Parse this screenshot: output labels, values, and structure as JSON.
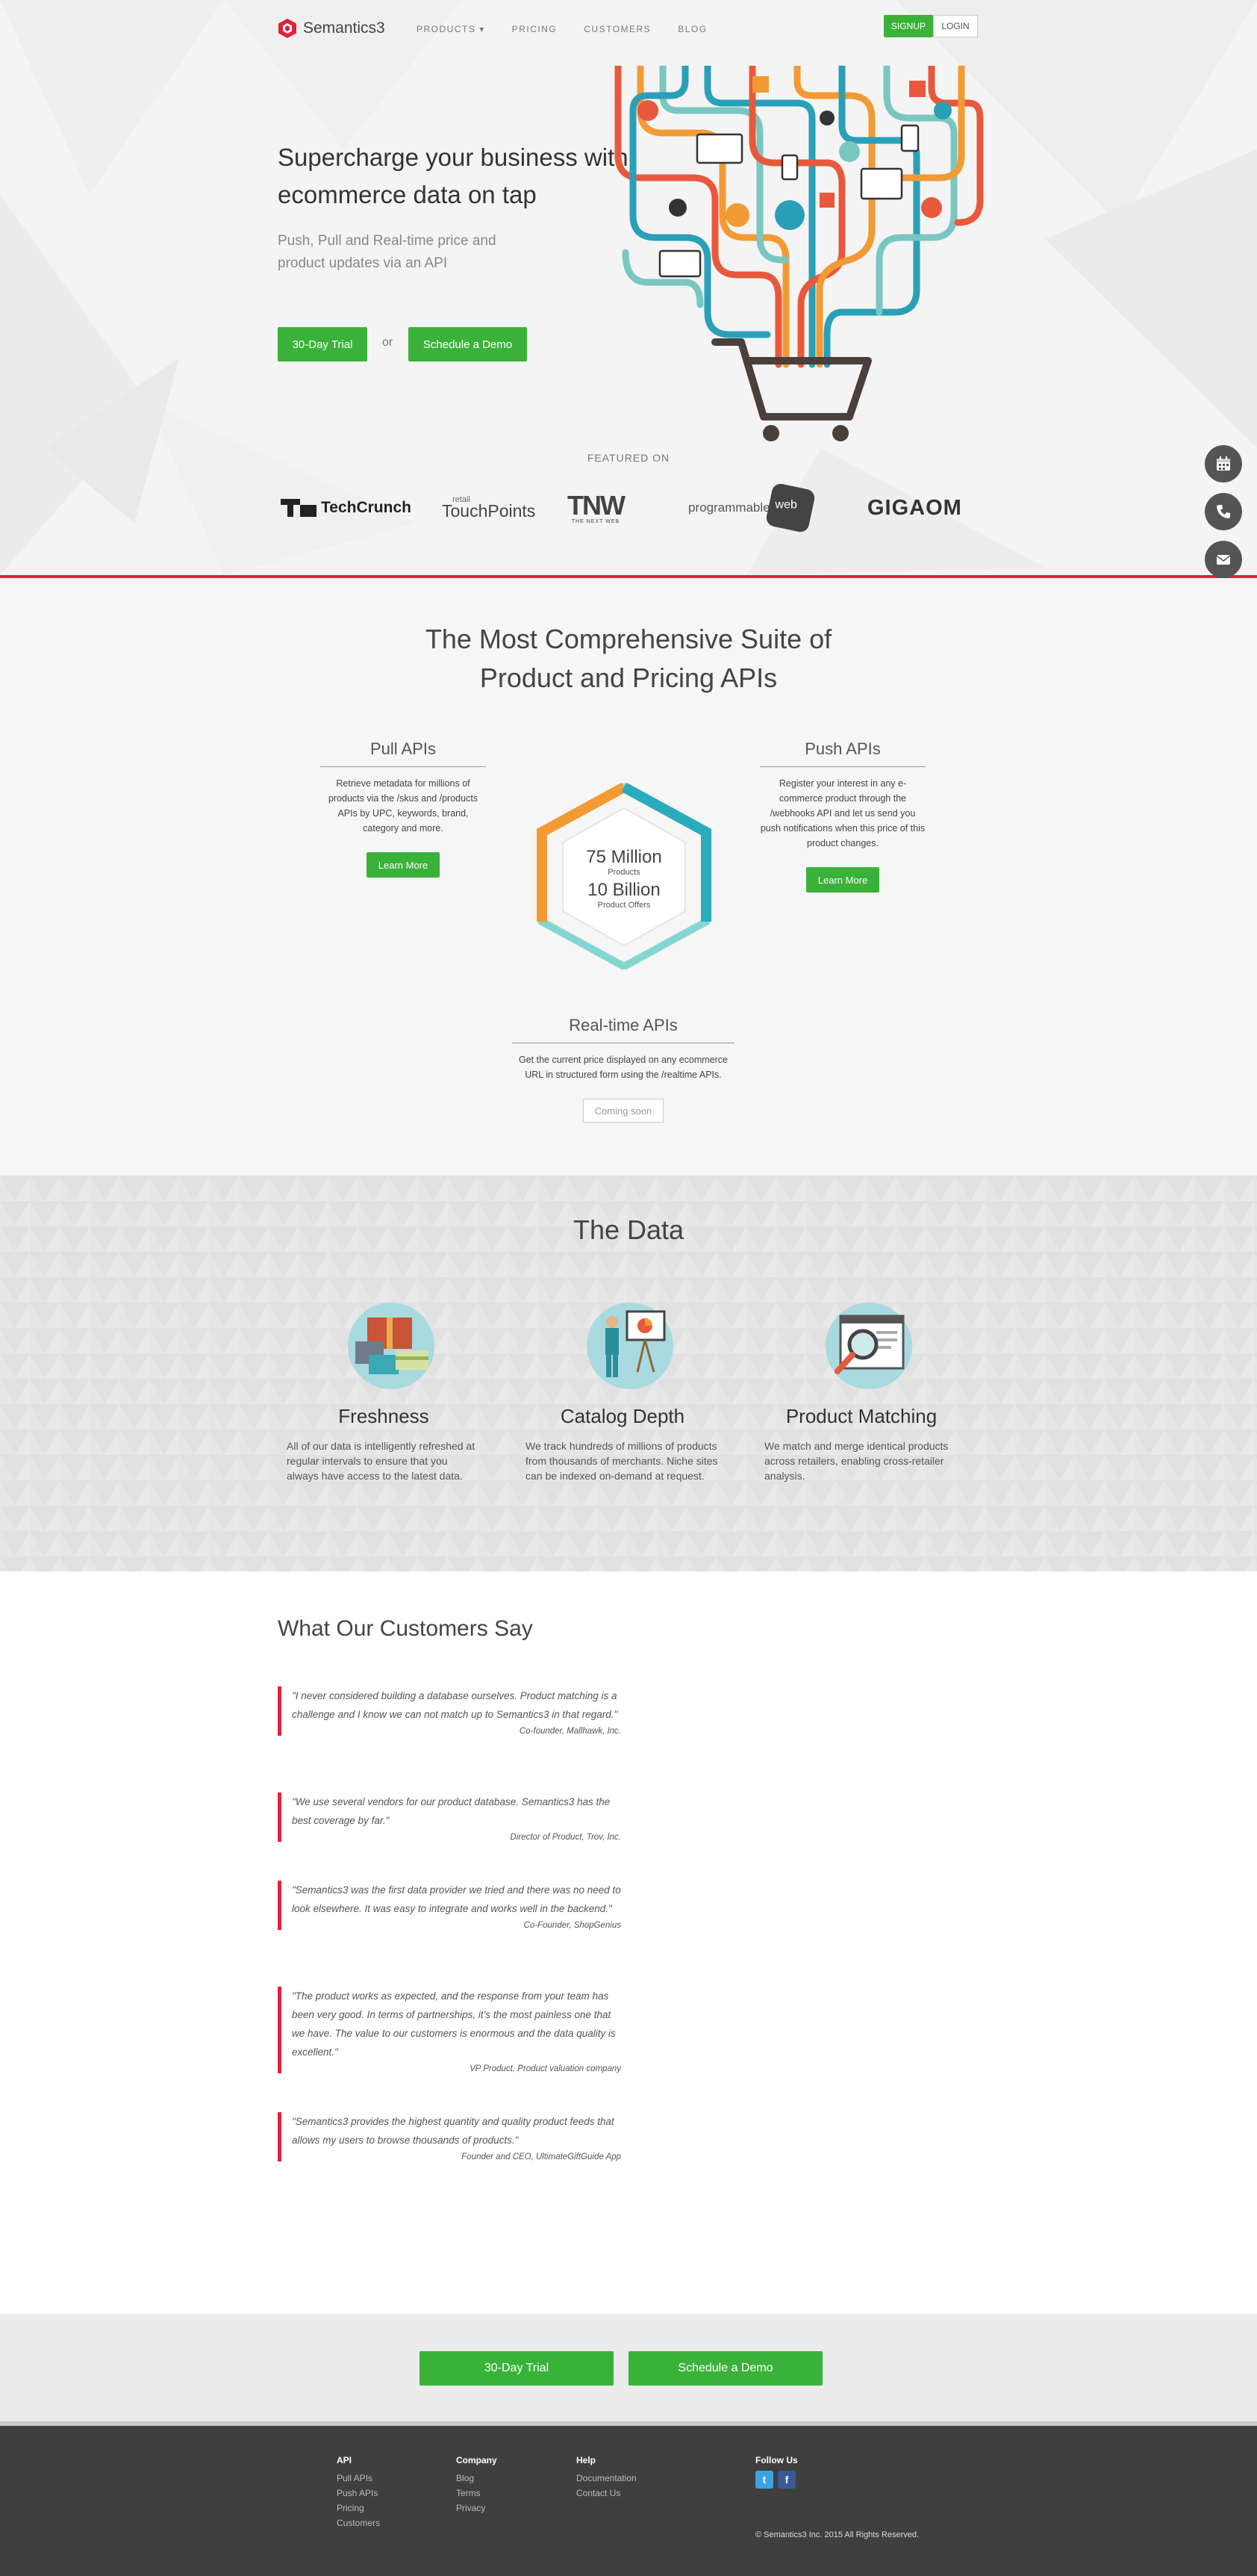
{
  "brand": {
    "name": "Semantics3",
    "accent": "#e4203e",
    "green": "#3ab23a"
  },
  "nav": {
    "links": [
      "PRODUCTS",
      "PRICING",
      "CUSTOMERS",
      "BLOG"
    ],
    "signup": "SIGNUP",
    "login": "LOGIN"
  },
  "hero": {
    "title": "Supercharge your business with ecommerce data on tap",
    "subtitle": "Push, Pull and Real-time price and product updates via an API",
    "trial": "30-Day Trial",
    "or": "or",
    "demo": "Schedule a Demo",
    "featured": "FEATURED ON",
    "press": {
      "techcrunch": "TechCrunch",
      "touchpoints_small": "retail",
      "touchpoints": "TouchPoints",
      "tnw": "TNW",
      "tnw_sub": "THE NEXT WEB",
      "programmable": "programmable",
      "programmable_web": "web",
      "gigaom": "GIGAOM"
    }
  },
  "suite": {
    "title_line1": "The Most Comprehensive Suite of",
    "title_line2": "Product and Pricing APIs",
    "pull": {
      "heading": "Pull APIs",
      "desc": "Retrieve metadata for millions of products via the /skus and /products APIs by UPC, keywords, brand, category and more.",
      "button": "Learn More"
    },
    "push": {
      "heading": "Push APIs",
      "desc": "Register your interest in any e-commerce product through the /webhooks API and let us send you push notifications when this price of this product changes.",
      "button": "Learn More"
    },
    "hex": {
      "products_num": "75 Million",
      "products_label": "Products",
      "offers_num": "10 Billion",
      "offers_label": "Product Offers"
    },
    "realtime": {
      "heading": "Real-time APIs",
      "desc": "Get the current price displayed on any ecommerce URL in structured form using the /realtime APIs.",
      "button": "Coming soon"
    }
  },
  "data_section": {
    "title": "The Data",
    "cols": [
      {
        "heading": "Freshness",
        "text": "All of our data is intelligently refreshed at regular intervals to ensure that you always have access to the latest data.",
        "icon": "boxes-icon"
      },
      {
        "heading": "Catalog Depth",
        "text": "We track hundreds of millions of products from thousands of merchants. Niche sites can be indexed on-demand at request.",
        "icon": "presenter-icon"
      },
      {
        "heading": "Product Matching",
        "text": "We match and merge identical products across retailers, enabling cross-retailer analysis.",
        "icon": "magnifier-icon"
      }
    ]
  },
  "testimonials": {
    "title": "What Our Customers Say",
    "items": [
      {
        "quote": "\"I never considered building a database ourselves. Product matching is a challenge and I know we can not match up to Semantics3 in that regard.\"",
        "author": "Co-founder, Mallhawk, Inc."
      },
      {
        "quote": "\"We use several vendors for our product database. Semantics3 has the best coverage by far.\"",
        "author": "Director of Product, Trov, Inc."
      },
      {
        "quote": "\"Semantics3 was the first data provider we tried and there was no need to look elsewhere. It was easy to integrate and works well in the backend.\"",
        "author": "Co-Founder, ShopGenius"
      },
      {
        "quote": "\"The product works as expected, and the response from your team has been very good. In terms of partnerships, it's the most painless one that we have. The value to our customers is enormous and the data quality is excellent.\"",
        "author": "VP Product, Product valuation company"
      },
      {
        "quote": "\"Semantics3 provides the highest quantity and quality product feeds that allows my users to browse thousands of products.\"",
        "author": "Founder and CEO, UltimateGiftGuide App"
      }
    ]
  },
  "cta": {
    "trial": "30-Day Trial",
    "demo": "Schedule a Demo"
  },
  "footer": {
    "api": {
      "heading": "API",
      "links": [
        "Pull APIs",
        "Push APIs",
        "Pricing",
        "Customers"
      ]
    },
    "company": {
      "heading": "Company",
      "links": [
        "Blog",
        "Terms",
        "Privacy"
      ]
    },
    "help": {
      "heading": "Help",
      "links": [
        "Documentation",
        "Contact Us"
      ]
    },
    "follow": {
      "heading": "Follow Us",
      "twitter": "t",
      "facebook": "f"
    },
    "copyright": "© Semantics3 Inc. 2015 All Rights Reserved."
  }
}
